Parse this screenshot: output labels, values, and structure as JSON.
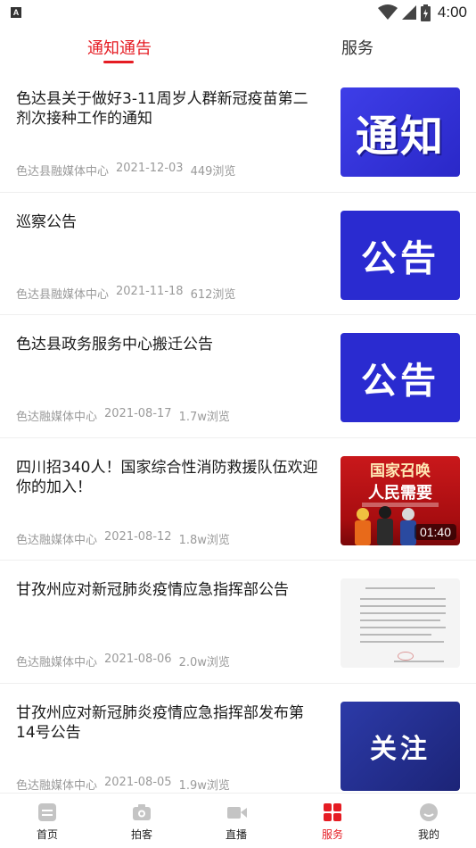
{
  "status_bar": {
    "badge": "A",
    "time": "4:00"
  },
  "tabs": [
    {
      "label": "通知通告",
      "active": true
    },
    {
      "label": "服务",
      "active": false
    }
  ],
  "news": [
    {
      "title": "色达县关于做好3-11周岁人群新冠疫苗第二剂次接种工作的通知",
      "source": "色达县融媒体中心",
      "date": "2021-12-03",
      "views": "449浏览",
      "thumb_text": "通知"
    },
    {
      "title": "巡察公告",
      "source": "色达县融媒体中心",
      "date": "2021-11-18",
      "views": "612浏览",
      "thumb_text": "公告"
    },
    {
      "title": "色达县政务服务中心搬迁公告",
      "source": "色达融媒体中心",
      "date": "2021-08-17",
      "views": "1.7w浏览",
      "thumb_text": "公告"
    },
    {
      "title": "四川招340人！国家综合性消防救援队伍欢迎你的加入！",
      "source": "色达融媒体中心",
      "date": "2021-08-12",
      "views": "1.8w浏览",
      "thumb_title": "国家召唤",
      "thumb_subtitle": "人民需要",
      "thumb_duration": "01:40"
    },
    {
      "title": "甘孜州应对新冠肺炎疫情应急指挥部公告",
      "source": "色达融媒体中心",
      "date": "2021-08-06",
      "views": "2.0w浏览"
    },
    {
      "title": "甘孜州应对新冠肺炎疫情应急指挥部发布第14号公告",
      "source": "色达融媒体中心",
      "date": "2021-08-05",
      "views": "1.9w浏览",
      "thumb_text": "关注"
    }
  ],
  "bottom_nav": [
    {
      "label": "首页",
      "icon": "home-icon",
      "active": false
    },
    {
      "label": "拍客",
      "icon": "camera-icon",
      "active": false
    },
    {
      "label": "直播",
      "icon": "video-icon",
      "active": false
    },
    {
      "label": "服务",
      "icon": "grid-icon",
      "active": true
    },
    {
      "label": "我的",
      "icon": "profile-icon",
      "active": false
    }
  ],
  "colors": {
    "accent": "#e51c23",
    "inactive_icon": "#c4c4c4",
    "meta_text": "#9a9a9a"
  }
}
